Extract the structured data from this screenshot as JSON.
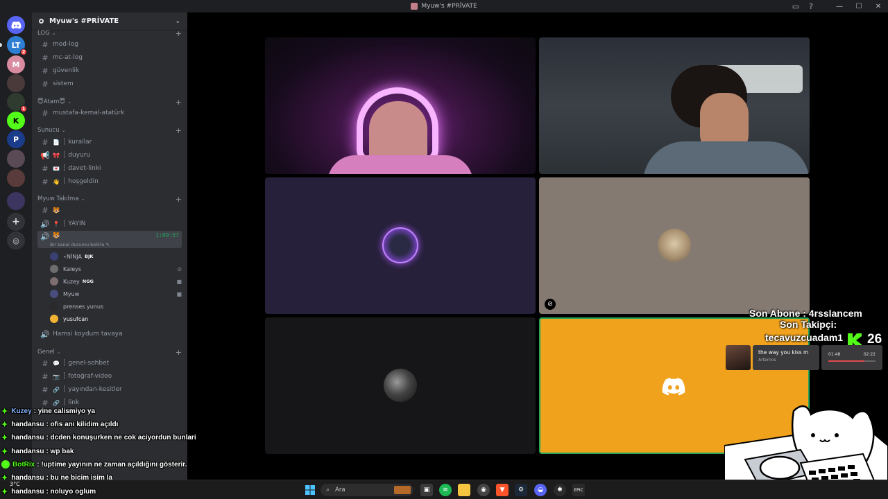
{
  "window": {
    "title": "Myuw's #PRİVATE"
  },
  "server": {
    "name": "Myuw's #PRİVATE"
  },
  "rail_badges": [
    "2",
    "1"
  ],
  "categories": {
    "log": "LOG",
    "atam": "😇Atam😇",
    "sunucu": "Sunucu",
    "takilma": "Myuw Takılma",
    "genel": "Genel"
  },
  "channels": {
    "mod_log": "mod-log",
    "mc_at_log": "mc-at-log",
    "guvenlik": "güvenlik",
    "sistem": "sistem",
    "ataturk": "mustafa-kemal-atatürk",
    "kurallar": "┆ kurallar",
    "duyuru": "┆ duyuru",
    "davet": "┆ davet-linki",
    "hosgeldin": "┆ hoşgeldin",
    "yayin": "┆ YAYIN",
    "voice_timer": "1:09:57",
    "voice_status": "Bir kanal durumu belirle",
    "hamsi": "Hamsi koydum tavaya",
    "genel_sohbet": "┆ genel-sohbet",
    "fotograf": "┆ fotoğraf-video",
    "kesitler": "┆ yayından-kesitler",
    "link": "┆ link"
  },
  "voice_users": [
    {
      "name": "⋆NİNJA",
      "tag": "BJK",
      "color": "#3b3f73"
    },
    {
      "name": "Kaleys",
      "tag": "",
      "color": "#6d6d6d"
    },
    {
      "name": "Kuzey",
      "tag": "NGG",
      "color": "#7c6e6e"
    },
    {
      "name": "Myuw",
      "tag": "",
      "color": "#4a4e7e"
    },
    {
      "name": "prenses yunus",
      "tag": "",
      "color": "#2a2a2a"
    },
    {
      "name": "yusufcan",
      "tag": "",
      "color": "#f0b232"
    }
  ],
  "overlay": {
    "sub_label": "Son Abone : 4rsslancem",
    "follower_label": "Son Takipçi:",
    "follower_name": "tecavuzcuadam1",
    "viewer_count": "26"
  },
  "music": {
    "song": "the way you kiss m",
    "artist": "Arternos",
    "elapsed": "01:48",
    "total": "02:22",
    "progress": 0.76
  },
  "chat": [
    {
      "user": "Kuzey",
      "text": ": yine calismiyo ya"
    },
    {
      "user": "handansu",
      "text": ": ofis anı kilidim açıldı"
    },
    {
      "user": "handansu",
      "text": ": dcden konuşurken ne cok aciyordun bunlari"
    },
    {
      "user": "handansu",
      "text": ": wp bak"
    },
    {
      "user": "BotRix",
      "text": ": !uptime yayının ne zaman açıldığını gösterir."
    },
    {
      "user": "handansu",
      "text": ": bu ne bicim isim la"
    },
    {
      "user": "handansu",
      "text": ": noluyo oglum"
    }
  ],
  "taskbar": {
    "search_placeholder": "Ara",
    "weather": "3°C"
  },
  "colors": {
    "rail_bg": "#1e1f22",
    "sidebar_bg": "#2b2d31",
    "accent_green": "#23a55a",
    "kick_green": "#53fc18",
    "yellow_tile": "#f0a21d"
  }
}
